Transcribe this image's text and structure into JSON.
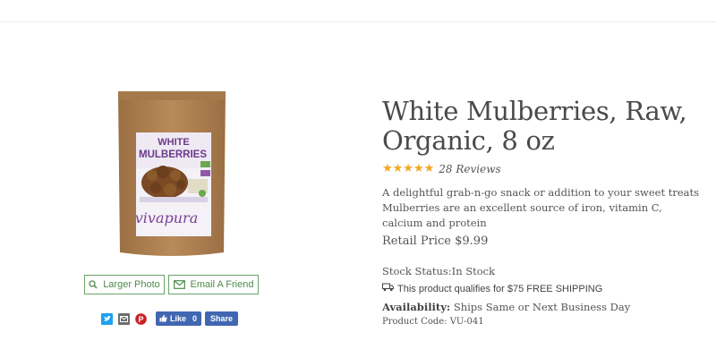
{
  "product": {
    "title": "White Mulberries, Raw, Organic, 8 oz",
    "rating_stars": "★★★★★",
    "reviews": "28 Reviews",
    "description": "A delightful grab-n-go snack or addition to your sweet treats Mulberries are an excellent source of iron, vitamin C, calcium and protein",
    "price": "Retail Price $9.99",
    "stock_status": "Stock Status:In Stock",
    "shipping": "This product qualifies for $75 FREE SHIPPING",
    "availability_label": "Availability:",
    "availability_value": "Ships Same or Next Business Day",
    "product_code": "Product Code: VU-041"
  },
  "packaging": {
    "line1": "WHITE",
    "line2": "MULBERRIES",
    "brand": "vivapura"
  },
  "buttons": {
    "larger_photo": "Larger Photo",
    "email_friend": "Email A Friend"
  },
  "social": {
    "like_label": "Like",
    "like_count": "0",
    "share_label": "Share"
  },
  "colors": {
    "star": "#f5a623",
    "button_green": "#4d8b4d",
    "facebook": "#4267b2",
    "twitter": "#1da1f2",
    "pinterest": "#cb2027"
  },
  "icons": {
    "larger_photo": "magnifier-icon",
    "email": "envelope-icon",
    "shipping": "truck-icon"
  }
}
